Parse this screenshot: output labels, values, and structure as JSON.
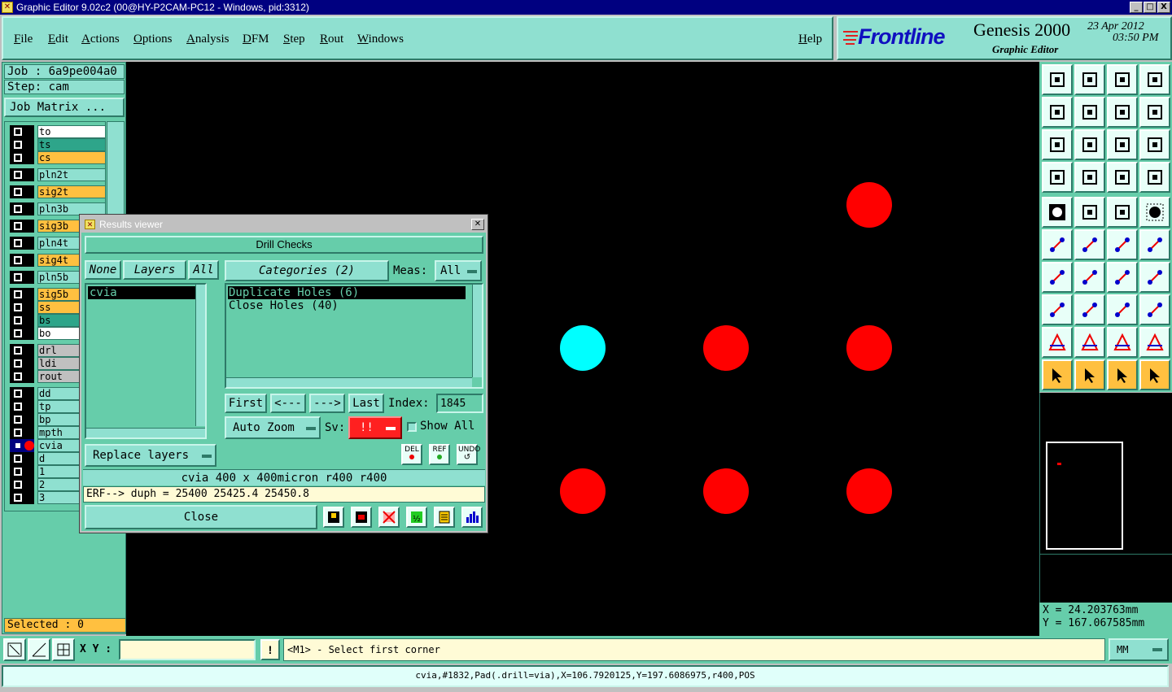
{
  "window": {
    "title": "Graphic Editor 9.02c2 (00@HY-P2CAM-PC12 - Windows, pid:3312)",
    "minimize": "_",
    "maximize": "□",
    "close": "X"
  },
  "menubar": {
    "items": [
      "File",
      "Edit",
      "Actions",
      "Options",
      "Analysis",
      "DFM",
      "Step",
      "Rout",
      "Windows"
    ],
    "help": "Help"
  },
  "logo": {
    "brand": "Frontline",
    "product": "Genesis 2000",
    "subtitle": "Graphic Editor",
    "date": "23 Apr 2012",
    "time": "03:50 PM"
  },
  "left": {
    "job": "Job : 6a9pe004a0",
    "step": "Step: cam",
    "job_matrix": "Job Matrix ...",
    "selected": "Selected : 0",
    "layers": [
      {
        "name": "to",
        "color": "#ffffff"
      },
      {
        "name": "ts",
        "color": "#2ea58a"
      },
      {
        "name": "cs",
        "color": "#ffc040"
      },
      {
        "name": "pln2t",
        "color": "#8fe0d0"
      },
      {
        "name": "sig2t",
        "color": "#ffc040"
      },
      {
        "name": "pln3b",
        "color": "#8fe0d0"
      },
      {
        "name": "sig3b",
        "color": "#ffc040"
      },
      {
        "name": "pln4t",
        "color": "#8fe0d0"
      },
      {
        "name": "sig4t",
        "color": "#ffc040"
      },
      {
        "name": "pln5b",
        "color": "#8fe0d0"
      },
      {
        "name": "sig5b",
        "color": "#ffc040"
      },
      {
        "name": "ss",
        "color": "#ffc040"
      },
      {
        "name": "bs",
        "color": "#2ea58a"
      },
      {
        "name": "bo",
        "color": "#ffffff"
      },
      {
        "name": "drl",
        "color": "#c0c0c0"
      },
      {
        "name": "ldi",
        "color": "#c0c0c0"
      },
      {
        "name": "rout",
        "color": "#c0c0c0"
      },
      {
        "name": "dd",
        "color": "#8fe0d0"
      },
      {
        "name": "tp",
        "color": "#8fe0d0"
      },
      {
        "name": "bp",
        "color": "#8fe0d0"
      },
      {
        "name": "mpth",
        "color": "#8fe0d0"
      },
      {
        "name": "cvia",
        "color": "#8fe0d0"
      },
      {
        "name": "d",
        "color": "#8fe0d0"
      },
      {
        "name": "1",
        "color": "#8fe0d0"
      },
      {
        "name": "2",
        "color": "#8fe0d0"
      },
      {
        "name": "3",
        "color": "#8fe0d0"
      }
    ]
  },
  "dialog": {
    "title": "Results viewer",
    "header": "Drill Checks",
    "none": "None",
    "layers": "Layers",
    "all": "All",
    "layer_items": [
      "cvia"
    ],
    "categories": "Categories (2)",
    "meas_label": "Meas:",
    "meas_value": "All",
    "category_items": [
      "Duplicate Holes (6)",
      "Close Holes (40)"
    ],
    "first": "First",
    "prev": "<---",
    "next": "--->",
    "last": "Last",
    "index_label": "Index:",
    "index_value": "1845",
    "replace_layers": "Replace layers",
    "auto_zoom": "Auto Zoom",
    "sv_label": "Sv:",
    "sv_value": "!!",
    "show_all": "Show All",
    "del": "DEL",
    "ref": "REF",
    "undo": "UNDO",
    "info1": "cvia  400 x 400micron  r400  r400",
    "info2": "ERF--> duph = 25400 25425.4 25450.8",
    "close": "Close"
  },
  "coords": {
    "x": "X  =  24.203763mm",
    "y": "Y  = 167.067585mm"
  },
  "bottom": {
    "xy_label": "X Y :",
    "xy_value": "",
    "excl": "!",
    "prompt": "<M1> - Select first corner",
    "units": "MM",
    "status": "cvia,#1832,Pad(.drill=via),X=106.7920125,Y=197.6086975,r400,POS"
  },
  "colors": {
    "panel": "#66cdaa",
    "light_panel": "#8fe0d0",
    "pad_red": "#ff0000",
    "pad_cyan": "#00ffff",
    "sv_red": "#ff2020"
  }
}
